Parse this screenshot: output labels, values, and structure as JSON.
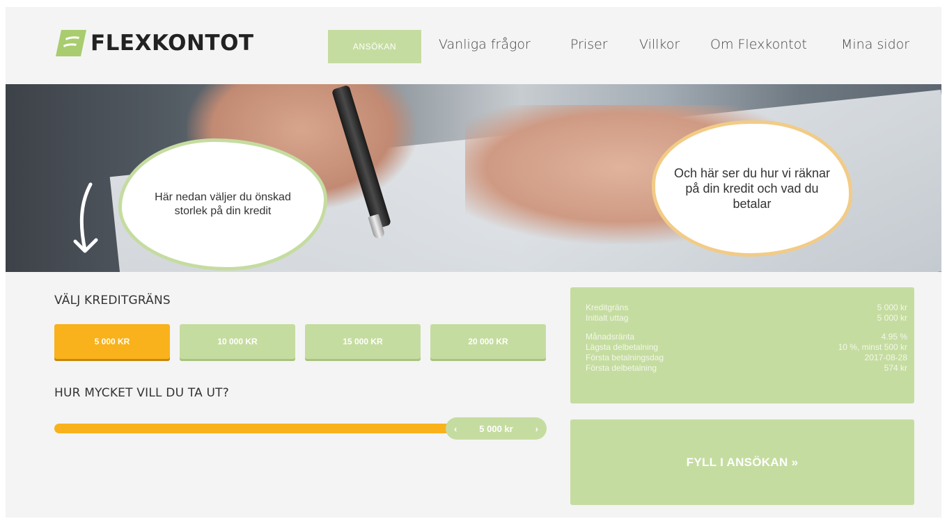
{
  "header": {
    "logo_text": "FLEXKONTOT",
    "nav": {
      "apply": "ANSÖKAN",
      "faq": "Vanliga frågor",
      "prices": "Priser",
      "terms": "Villkor",
      "about": "Om Flexkontot",
      "my_pages": "Mina sidor"
    }
  },
  "hero": {
    "bubble_left": "Här nedan väljer du önskad storlek på din kredit",
    "bubble_right": "Och här ser du hur vi räknar på din kredit och vad du betalar"
  },
  "calculator": {
    "limit_title": "VÄLJ KREDITGRÄNS",
    "amounts": [
      "5 000 KR",
      "10 000 KR",
      "15 000 KR",
      "20 000 KR"
    ],
    "selected_index": 0,
    "withdraw_title": "HUR MYCKET VILL DU TA UT?",
    "slider": {
      "value_label": "5 000 kr",
      "prev_icon": "‹",
      "next_icon": "›",
      "fill_fraction": 1.0
    }
  },
  "summary": {
    "rows": [
      {
        "label": "Kreditgräns",
        "value": "5 000 kr"
      },
      {
        "label": "Initialt uttag",
        "value": "5 000 kr"
      },
      {
        "label": "Månadsränta",
        "value": "4.95 %"
      },
      {
        "label": "Lägsta delbetalning",
        "value": "10 %, minst 500 kr"
      },
      {
        "label": "Första betalningsdag",
        "value": "2017-08-28"
      },
      {
        "label": "Första delbetalning",
        "value": "574 kr"
      }
    ]
  },
  "cta": {
    "label": "FYLL I ANSÖKAN »"
  },
  "colors": {
    "accent_green": "#c5dca0",
    "accent_orange": "#f9b21b",
    "bubble_right_border": "#f2cb86"
  }
}
